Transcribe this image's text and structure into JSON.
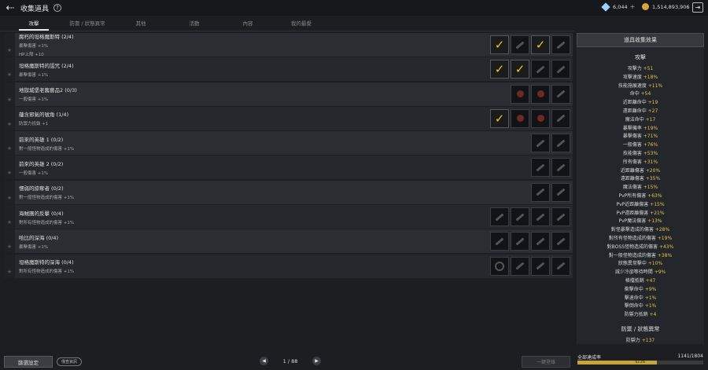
{
  "header": {
    "title": "收集道具",
    "help": "?",
    "gems": "6,044",
    "coins": "1,514,893,906",
    "plus": "+"
  },
  "tabs": [
    "攻擊",
    "防禦 / 狀態異常",
    "其他",
    "活動",
    "內容",
    "我的最愛"
  ],
  "rows": [
    {
      "name": "腐朽的坦格魔斯特 (2/4)",
      "effects": [
        "暴擊傷害 +1%",
        "HP上限 +10"
      ],
      "slots": [
        "check",
        "item",
        "check",
        "item"
      ]
    },
    {
      "name": "坦格魔斯特的詛咒 (2/4)",
      "effects": [
        "暴擊傷害 +1%"
      ],
      "slots": [
        "check",
        "check",
        "item",
        "item"
      ]
    },
    {
      "name": "地獄城堡老舊藝品2 (0/3)",
      "effects": [
        "一般傷害 +1%"
      ],
      "slots": [
        "red",
        "red",
        "item"
      ]
    },
    {
      "name": "蘊含邪氣的號角 (1/4)",
      "effects": [
        "防禦力抵銷 +1"
      ],
      "slots": [
        "check",
        "red",
        "red",
        "item"
      ]
    },
    {
      "name": "前來的英雄 1 (0/2)",
      "effects": [
        "對一般怪物造成的傷害 +1%"
      ],
      "slots": [
        "item",
        "item"
      ]
    },
    {
      "name": "前來的英雄 2 (0/2)",
      "effects": [
        "一般傷害 +1%"
      ],
      "slots": [
        "item",
        "item"
      ]
    },
    {
      "name": "懦弱的掠奪者 (0/2)",
      "effects": [
        "對一般怪物造成的傷害 +1%"
      ],
      "slots": [
        "item",
        "item"
      ]
    },
    {
      "name": "海賊團的反擊 (0/4)",
      "effects": [
        "對所有怪物造成的傷害 +1%"
      ],
      "slots": [
        "item",
        "item",
        "item",
        "item"
      ]
    },
    {
      "name": "哈比的深海 (0/4)",
      "effects": [
        "暴擊傷害 +1%"
      ],
      "slots": [
        "item",
        "item",
        "item",
        "item"
      ]
    },
    {
      "name": "坦格魔斯特的深海 (0/4)",
      "effects": [
        "對所有怪物造成的傷害 +1%"
      ],
      "slots": [
        "ring",
        "item",
        "item",
        "item"
      ]
    }
  ],
  "panel": {
    "header": "道具收集效果",
    "attack_title": "攻擊",
    "attack_stats": [
      {
        "label": "攻擊力",
        "value": "+51"
      },
      {
        "label": "攻擊速度",
        "value": "+18%"
      },
      {
        "label": "技能施展速度",
        "value": "+11%"
      },
      {
        "label": "命中",
        "value": "+54"
      },
      {
        "label": "近距離命中",
        "value": "+19"
      },
      {
        "label": "遠距離命中",
        "value": "+27"
      },
      {
        "label": "魔法命中",
        "value": "+17"
      },
      {
        "label": "暴擊機率",
        "value": "+19%"
      },
      {
        "label": "暴擊傷害",
        "value": "+71%"
      },
      {
        "label": "一般傷害",
        "value": "+76%"
      },
      {
        "label": "技能傷害",
        "value": "+53%"
      },
      {
        "label": "所有傷害",
        "value": "+31%"
      },
      {
        "label": "近距離傷害",
        "value": "+20%"
      },
      {
        "label": "遠距離傷害",
        "value": "+35%"
      },
      {
        "label": "魔法傷害",
        "value": "+15%"
      },
      {
        "label": "PvP所有傷害",
        "value": "+63%"
      },
      {
        "label": "PvP近距離傷害",
        "value": "+15%"
      },
      {
        "label": "PvP遠距離傷害",
        "value": "+21%"
      },
      {
        "label": "PvP魔法傷害",
        "value": "+13%"
      },
      {
        "label": "對怪暴擊造成的傷害",
        "value": "+28%"
      },
      {
        "label": "對所有怪物造成的傷害",
        "value": "+19%"
      },
      {
        "label": "對BOSS怪物造成的傷害",
        "value": "+43%"
      },
      {
        "label": "對一般怪物造成的傷害",
        "value": "+38%"
      },
      {
        "label": "狀態異常擊中",
        "value": "+10%"
      },
      {
        "label": "減少冷卻等待時間",
        "value": "+9%"
      },
      {
        "label": "格擋抵銷",
        "value": "+47"
      },
      {
        "label": "衝擊命中",
        "value": "+9%"
      },
      {
        "label": "擊退命中",
        "value": "+1%"
      },
      {
        "label": "擊倒命中",
        "value": "+1%"
      },
      {
        "label": "防禦力抵銷",
        "value": "+4"
      }
    ],
    "defense_title": "防禦 / 狀態異常",
    "defense_stats": [
      {
        "label": "防禦力",
        "value": "+137"
      }
    ]
  },
  "footer": {
    "filter_label": "篩選設定",
    "pill_label": "僅查資訊",
    "page": "1 / 88",
    "register_label": "一鍵登錄",
    "rate_label": "全部達成率",
    "rate_value": "1141/1804",
    "rate_fraction": 0.632,
    "rate_pct_text": "63.2%"
  }
}
